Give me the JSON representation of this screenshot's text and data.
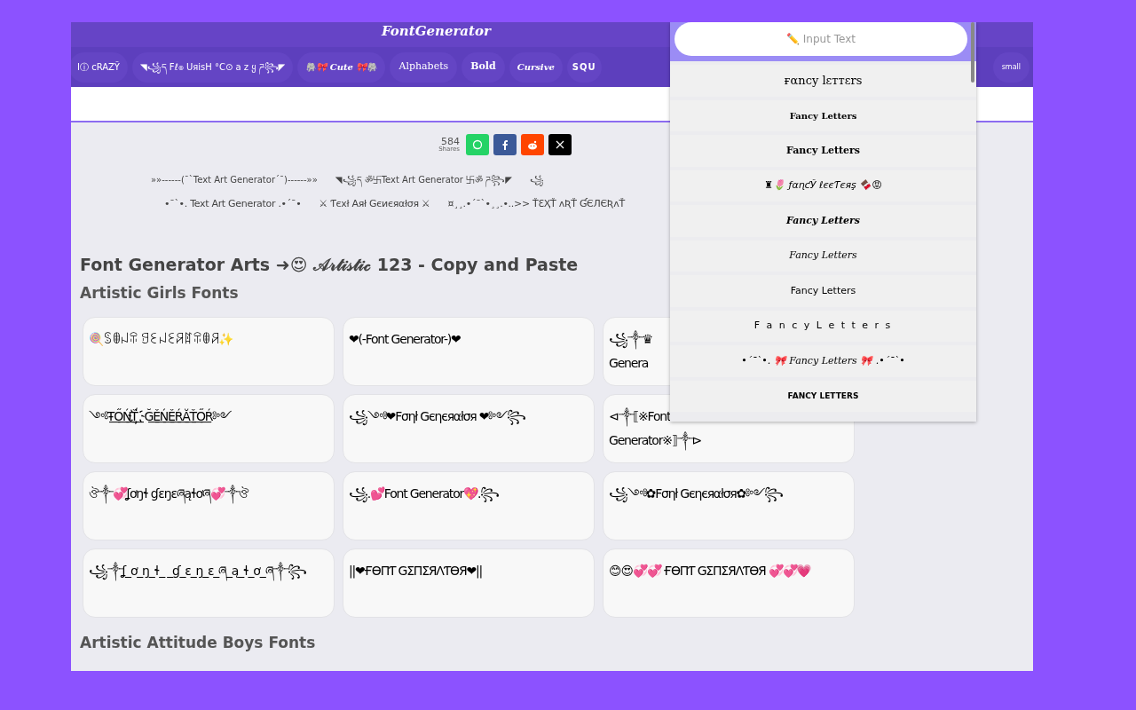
{
  "logo": "FontGenerator",
  "nav": [
    {
      "label": "Iⓘ ᴄRAZY̆",
      "kind": "plain"
    },
    {
      "label": "◥꧁ད Fℓ๏ UяisН °C⊙ a z ყ ཌ꧂◤",
      "kind": "plain"
    },
    {
      "label": "🐘🎀 Cute 🎀🐘",
      "kind": "italic"
    },
    {
      "label": "Alphabets",
      "kind": "mono"
    },
    {
      "label": "Bold",
      "kind": "bold"
    },
    {
      "label": "Cursive",
      "kind": "italic"
    },
    {
      "label": "SQU",
      "kind": "boxed"
    },
    {
      "label": "small",
      "kind": "small"
    }
  ],
  "share": {
    "count": "584",
    "label": "Shares",
    "buttons": [
      {
        "kind": "whatsapp"
      },
      {
        "kind": "facebook"
      },
      {
        "kind": "reddit"
      },
      {
        "kind": "x"
      }
    ]
  },
  "art_rows": [
    [
      "»»------(¯`Text Art Generator´¯)------»»",
      "◥꧁ད ॐ卐Text Art Generator 卐ॐ ཌ꧂◤",
      "꧁"
    ],
    [
      "•¯`•. Text Art Generator .•´¯•",
      "⚔ Ƭєxł Aяł Gєиєяαłσя ⚔",
      "¤¸¸.•´¯`•¸¸.•..>> ŤƐҲŤ ʌƦŤ ƓЄЛЄƦʌŤ"
    ]
  ],
  "title": "Font Generator Arts ➜😍 𝒜𝓇𝓉𝒾𝓈𝓉𝒾𝒸 123 - Copy and Paste",
  "section": "Artistic Girls Fonts",
  "cards": [
    "🍭ꌗꂦꈤꋖ ꍌꏂꈤꏂꋪꍏꋖꂦꋪ✨",
    "❤(-Font Generator-)❤",
    "꧁༒♛\nGenera",
    "༺Ŧ͟Ő͟Ń͟Ť͟ ҉Ğ͟Ě͟Ń͟Ě͟Ŕ͟Ă͟Ť͟Ő͟Ŕ༻",
    "꧁༺❤Fσηł Gєηєяαłσя ❤༻꧂",
    "⊲༒⟦※Font\nGenerator※⟧༒⊳",
    "ঔ༒💞ʆơŋɬ ɠɛŋɛཞąɬơཞ💞༒ঔ",
    "꧁.💕Font Generator💖.꧂",
    "꧁༺✿Fσηł Gєηєяαłσя✿༻꧂",
    "꧁༒ʆ_ơ_ŋ_ɬ_ _ɠ_ɛ_ŋ_ɛ_ཞ_ą_ɬ_ơ_ཞ༒꧂",
    "||❤ҒӨПƬ GΣПΣЯΛƬӨЯ❤||",
    "😊😍💞💞 ҒӨПƬ GΣПΣЯΛƬӨЯ 💞💞💗"
  ],
  "next_section": "Artistic Attitude Boys Fonts",
  "dropdown": {
    "placeholder": "✏️ Input Text",
    "items": [
      {
        "text": "ғαncy lεттεrs",
        "kind": "thin"
      },
      {
        "text": "Fancy Letters",
        "kind": "blackletter"
      },
      {
        "text": "Fancy Letters",
        "kind": "blackletter-bold"
      },
      {
        "text": "♜🌷 ƒαɳƈЎ ℓєєƬєяş 🍫😡",
        "kind": "mixed"
      },
      {
        "text": "Fancy Letters",
        "kind": "bold-script"
      },
      {
        "text": "Fancy Letters",
        "kind": "script"
      },
      {
        "text": "Fancy Letters",
        "kind": "plain"
      },
      {
        "text": "F a n c y L e t t e r s",
        "kind": "spaced"
      },
      {
        "text": "•´¯`•. 🎀 Fancy Letters 🎀 .•´¯`•",
        "kind": "script"
      },
      {
        "text": "FANCY LETTERS",
        "kind": "caps"
      }
    ]
  }
}
